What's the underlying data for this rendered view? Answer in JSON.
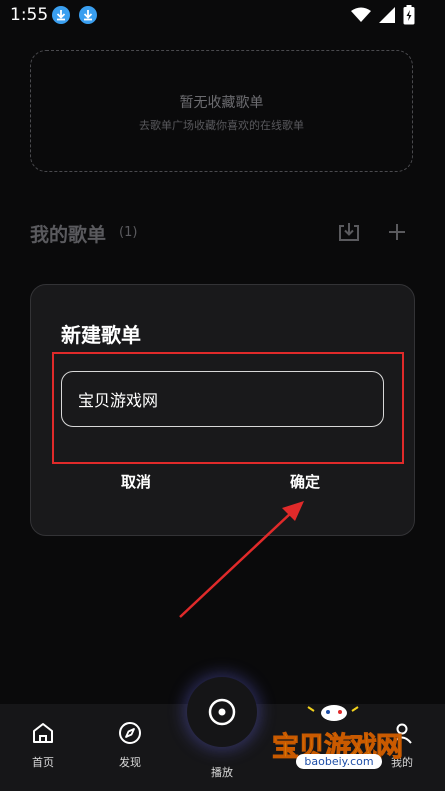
{
  "status_bar": {
    "time": "1:55"
  },
  "favorites_empty": {
    "title": "暂无收藏歌单",
    "subtitle": "去歌单广场收藏你喜欢的在线歌单"
  },
  "my_playlists": {
    "title": "我的歌单",
    "count": "(1)"
  },
  "dialog": {
    "title": "新建歌单",
    "input_value": "宝贝游戏网",
    "cancel_label": "取消",
    "confirm_label": "确定"
  },
  "bottom_nav": {
    "home": "首页",
    "discover": "发现",
    "play": "播放",
    "mine": "我的"
  },
  "watermark": {
    "text": "宝贝游戏网",
    "url": "baobeiy.com"
  },
  "colors": {
    "background": "#0a0a0b",
    "highlight": "#e02a2a",
    "download_badge": "#3a9ff0"
  },
  "icons": [
    "download-icon",
    "wifi-icon",
    "signal-icon",
    "battery-icon",
    "import-icon",
    "plus-icon",
    "home-icon",
    "compass-icon",
    "disc-icon",
    "profile-icon"
  ]
}
